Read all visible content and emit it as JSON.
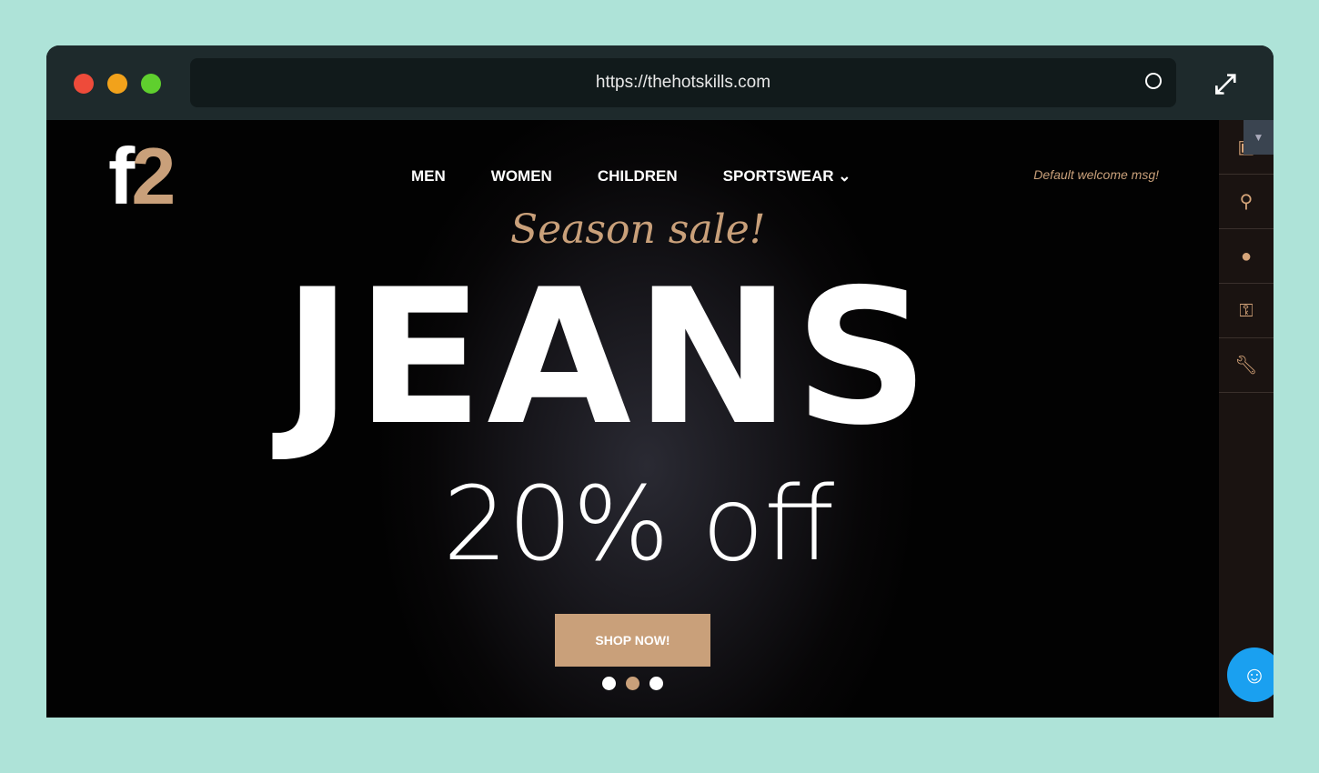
{
  "browser": {
    "url": "https://thehotskills.com",
    "colors": {
      "close": "#ee4b3a",
      "minimize": "#f2a21b",
      "maximize": "#5fcf2e"
    }
  },
  "site": {
    "logo": {
      "letter": "f",
      "number": "2"
    },
    "nav": [
      "MEN",
      "WOMEN",
      "CHILDREN",
      "SPORTSWEAR ⌄"
    ],
    "welcome": "Default welcome msg!",
    "hero": {
      "subtitle": "Season sale!",
      "title": "JEANS",
      "discount": "20% off",
      "button": "SHOP NOW!",
      "slides": 3,
      "active_slide": 2
    },
    "sidebar": [
      "cart-icon",
      "search-icon",
      "user-icon",
      "key-icon",
      "wrench-icon"
    ],
    "accent": "#c9a07a"
  }
}
